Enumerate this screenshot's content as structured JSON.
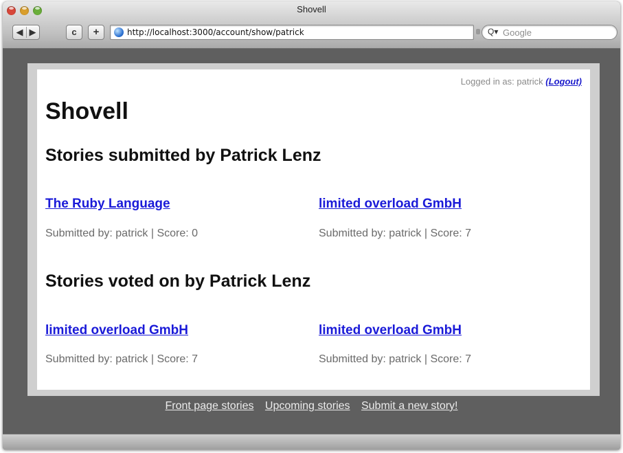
{
  "window": {
    "title": "Shovell"
  },
  "toolbar": {
    "back_glyph": "◀",
    "forward_glyph": "▶",
    "reload_glyph": "c",
    "add_glyph": "+",
    "url": "http://localhost:3000/account/show/patrick",
    "search_placeholder": "Google",
    "search_glyph": "Q▾"
  },
  "page": {
    "login_text": "Logged in as: patrick",
    "logout_label": "(Logout)",
    "site_title": "Shovell",
    "submitted_heading": "Stories submitted by Patrick Lenz",
    "voted_heading": "Stories voted on by Patrick Lenz",
    "submitted_stories": [
      {
        "title": "The Ruby Language",
        "meta": "Submitted by: patrick | Score: 0"
      },
      {
        "title": "limited overload GmbH",
        "meta": "Submitted by: patrick | Score: 7"
      }
    ],
    "voted_stories": [
      {
        "title": "limited overload GmbH",
        "meta": "Submitted by: patrick | Score: 7"
      },
      {
        "title": "limited overload GmbH",
        "meta": "Submitted by: patrick | Score: 7"
      }
    ]
  },
  "footer": {
    "links": [
      "Front page stories",
      "Upcoming stories",
      "Submit a new story!"
    ]
  },
  "colors": {
    "link": "#1a1ad8",
    "page_bg": "#5f5f5f",
    "frame": "#cfcfcf"
  }
}
